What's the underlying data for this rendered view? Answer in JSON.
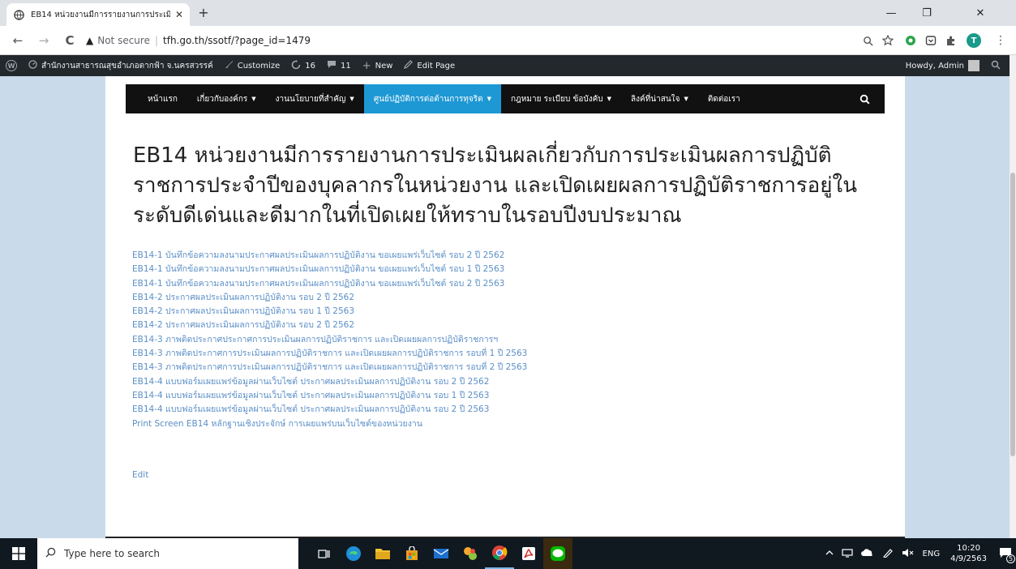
{
  "browser": {
    "tab_title": "EB14 หน่วยงานมีการรายงานการประเมิ",
    "close_glyph": "✕",
    "new_tab_glyph": "+",
    "minimize_glyph": "—",
    "restore_glyph": "❐",
    "window_close_glyph": "✕",
    "back_glyph": "←",
    "forward_glyph": "→",
    "reload_glyph": "C",
    "warning_glyph": "▲",
    "security_label": "Not secure",
    "separator": "|",
    "url": "tfh.go.th/ssotf/?page_id=1479",
    "profile_initial": "T",
    "menu_glyph": "⋮"
  },
  "adminbar": {
    "wp_logo_glyph": "W",
    "site_name": "สำนักงานสาธารณสุขอำเภอตากฟ้า จ.นครสวรรค์",
    "customize_label": "Customize",
    "updates_count": "16",
    "comments_count": "11",
    "new_label": "New",
    "edit_page_label": "Edit Page",
    "howdy_label": "Howdy, Admin"
  },
  "nav": {
    "items": [
      {
        "label": "หน้าแรก",
        "dropdown": false,
        "active": false
      },
      {
        "label": "เกี่ยวกับองค์กร",
        "dropdown": true,
        "active": false
      },
      {
        "label": "งานนโยบายที่สำคัญ",
        "dropdown": true,
        "active": false
      },
      {
        "label": "ศูนย์ปฏิบัติการต่อต้านการทุจริต",
        "dropdown": true,
        "active": true
      },
      {
        "label": "กฎหมาย ระเบียบ ข้อบังคับ",
        "dropdown": true,
        "active": false
      },
      {
        "label": "ลิงค์ที่น่าสนใจ",
        "dropdown": true,
        "active": false
      },
      {
        "label": "ติดต่อเรา",
        "dropdown": false,
        "active": false
      }
    ]
  },
  "content": {
    "title": "EB14 หน่วยงานมีการรายงานการประเมินผลเกี่ยวกับการประเมินผลการปฏิบัติราชการประจำปีของบุคลากรในหน่วยงาน และเปิดเผยผลการปฏิบัติราชการอยู่ในระดับดีเด่นและดีมากในที่เปิดเผยให้ทราบในรอบปีงบประมาณ",
    "links": [
      "EB14-1 บันทึกข้อความลงนามประกาศผลประเมินผลการปฏิบัติงาน ขอเผยแพร่เว็บไซต์ รอบ 2 ปี 2562",
      "EB14-1 บันทึกข้อความลงนามประกาศผลประเมินผลการปฏิบัติงาน ขอเผยแพร่เว็บไซต์ รอบ 1 ปี 2563",
      "EB14-1 บันทึกข้อความลงนามประกาศผลประเมินผลการปฏิบัติงาน ขอเผยแพร่เว็บไซต์ รอบ 2 ปี 2563",
      "EB14-2 ประกาศผลประเมินผลการปฏิบัติงาน รอบ 2 ปี 2562",
      "EB14-2 ประกาศผลประเมินผลการปฏิบัติงาน รอบ 1 ปี 2563",
      "EB14-2 ประกาศผลประเมินผลการปฏิบัติงาน รอบ 2 ปี 2562",
      "EB14-3 ภาพติดประกาศประกาศการประเมินผลการปฏิบัติราชการ และเปิดเผยผลการปฏิบัติราชการฯ",
      "EB14-3 ภาพติดประกาศการประเมินผลการปฏิบัติราชการ และเปิดเผยผลการปฏิบัติราชการ รอบที่ 1 ปี 2563",
      "EB14-3 ภาพติดประกาศการประเมินผลการปฏิบัติราชการ และเปิดเผยผลการปฏิบัติราชการ รอบที่ 2 ปี 2563",
      "EB14-4 แบบฟอร์มเผยแพร่ข้อมูลผ่านเว็บไซต์ ประกาศผลประเมินผลการปฏิบัติงาน รอบ 2 ปี 2562",
      "EB14-4 แบบฟอร์มเผยแพร่ข้อมูลผ่านเว็บไซต์ ประกาศผลประเมินผลการปฏิบัติงาน รอบ 1 ปี 2563",
      "EB14-4 แบบฟอร์มเผยแพร่ข้อมูลผ่านเว็บไซต์ ประกาศผลประเมินผลการปฏิบัติงาน รอบ 2 ปี 2563",
      "Print Screen EB14 หลักฐานเชิงประจักษ์ การเผยแพร่บนเว็บไซต์ของหน่วยงาน"
    ],
    "edit_label": "Edit"
  },
  "taskbar": {
    "search_placeholder": "Type here to search",
    "language": "ENG",
    "time": "10:20",
    "date": "4/9/2563",
    "notification_count": "5",
    "apps": [
      {
        "name": "task-view",
        "color": "#101820"
      },
      {
        "name": "edge",
        "color": "#1f8fd8"
      },
      {
        "name": "file-explorer",
        "color": "#f2c230"
      },
      {
        "name": "store",
        "color": "#e8a020"
      },
      {
        "name": "mail",
        "color": "#1c6fd0"
      },
      {
        "name": "app-pinwheel",
        "color": "#f0a830"
      },
      {
        "name": "chrome",
        "color": "#db4437"
      },
      {
        "name": "acrobat",
        "color": "#d0261f"
      },
      {
        "name": "line",
        "color": "#00b900"
      }
    ]
  },
  "colors": {
    "link": "#5b8fc7",
    "nav_active": "#1e98d4",
    "adminbar": "#23282d",
    "page_bg": "#c9daea"
  }
}
